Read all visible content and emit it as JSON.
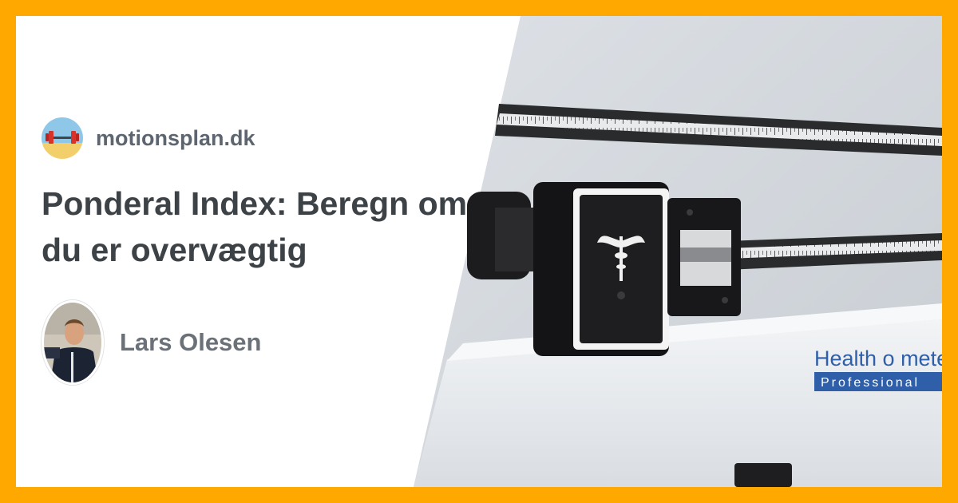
{
  "site": {
    "name": "motionsplan.dk",
    "logo_icon": "barbell-beach-icon"
  },
  "article": {
    "title": "Ponderal Index: Beregn om du er overvægtig"
  },
  "author": {
    "name": "Lars Olesen",
    "avatar_icon": "author-portrait-icon"
  },
  "hero": {
    "icon": "medical-scale-photo",
    "scale_brand": "Health o meter",
    "scale_sub": "Professional"
  },
  "colors": {
    "frame": "#FFA900",
    "card": "#FFFFFF",
    "title": "#3D4247",
    "brand_text": "#5D6670",
    "scale_brand": "#2F5FA8"
  }
}
